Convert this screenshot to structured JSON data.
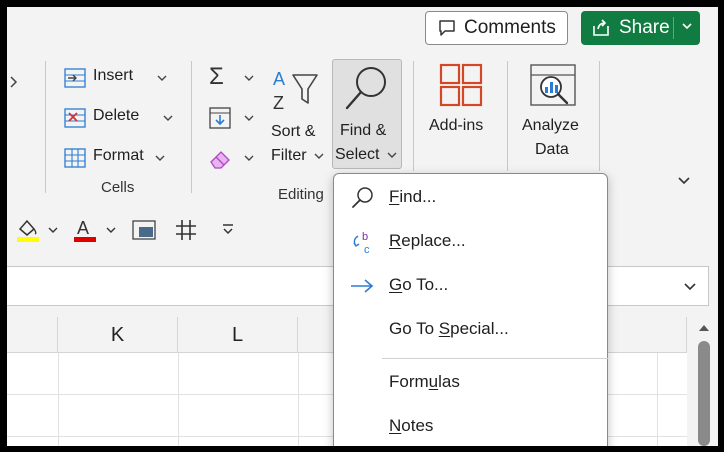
{
  "topbar": {
    "comments_label": "Comments",
    "share_label": "Share"
  },
  "ribbon": {
    "cells": {
      "insert_label": "Insert",
      "delete_label": "Delete",
      "format_label": "Format",
      "group_label": "Cells"
    },
    "editing": {
      "sort_line1": "Sort &",
      "sort_line2": "Filter",
      "find_line1": "Find &",
      "find_line2": "Select",
      "group_label": "Editing"
    },
    "addins_label": "Add-ins",
    "analyze_line1": "Analyze",
    "analyze_line2": "Data"
  },
  "colors": {
    "share_green": "#107c41",
    "fill_yellow": "#ffff00",
    "font_red": "#e00000",
    "addins_orange": "#d24726",
    "replace_blue": "#2b7cd3",
    "replace_purple": "#7b2fa8"
  },
  "grid": {
    "columns": [
      "K",
      "L"
    ]
  },
  "menu": {
    "items": [
      {
        "key": "F",
        "rest": "ind...",
        "icon": "search-icon"
      },
      {
        "key": "R",
        "rest": "eplace...",
        "icon": "replace-icon"
      },
      {
        "key": "G",
        "rest": "o To...",
        "icon": "arrow-right-icon"
      },
      {
        "pre": "Go To ",
        "key": "S",
        "rest": "pecial...",
        "icon": "none"
      },
      {
        "pre": "Form",
        "key": "u",
        "rest": "las",
        "icon": "none"
      },
      {
        "key": "N",
        "rest": "otes",
        "icon": "none"
      }
    ]
  }
}
